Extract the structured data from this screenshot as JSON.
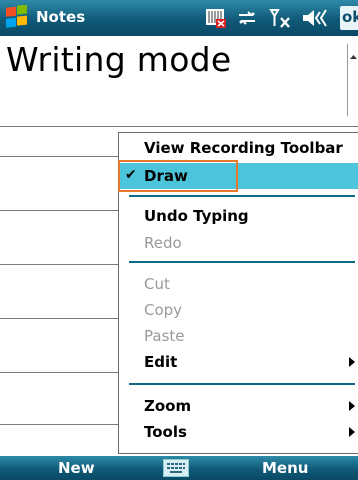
{
  "titlebar": {
    "app_title": "Notes",
    "ok_label": "ok"
  },
  "document": {
    "heading": "Writing mode"
  },
  "menu": {
    "items": [
      {
        "label": "View Recording Toolbar",
        "enabled": true,
        "checked": false,
        "submenu": false
      },
      {
        "label": "Draw",
        "enabled": true,
        "checked": true,
        "selected": true,
        "submenu": false
      },
      {
        "label": "Undo Typing",
        "enabled": true,
        "checked": false,
        "submenu": false
      },
      {
        "label": "Redo",
        "enabled": false,
        "checked": false,
        "submenu": false
      },
      {
        "label": "Cut",
        "enabled": false,
        "checked": false,
        "submenu": false
      },
      {
        "label": "Copy",
        "enabled": false,
        "checked": false,
        "submenu": false
      },
      {
        "label": "Paste",
        "enabled": false,
        "checked": false,
        "submenu": false
      },
      {
        "label": "Edit",
        "enabled": true,
        "checked": false,
        "submenu": true
      },
      {
        "label": "Zoom",
        "enabled": true,
        "checked": false,
        "submenu": true
      },
      {
        "label": "Tools",
        "enabled": true,
        "checked": false,
        "submenu": true
      }
    ],
    "check_glyph": "✔"
  },
  "softkeys": {
    "left": "New",
    "right": "Menu"
  },
  "colors": {
    "titlebar": "#0f5a78",
    "selection": "#4cc4dc",
    "highlight_box": "#e8782a"
  },
  "icons": {
    "start": "windows-flag-icon",
    "tray": [
      "sim-card-icon",
      "connectivity-icon",
      "signal-off-icon",
      "speaker-icon"
    ],
    "keyboard": "keyboard-icon"
  }
}
